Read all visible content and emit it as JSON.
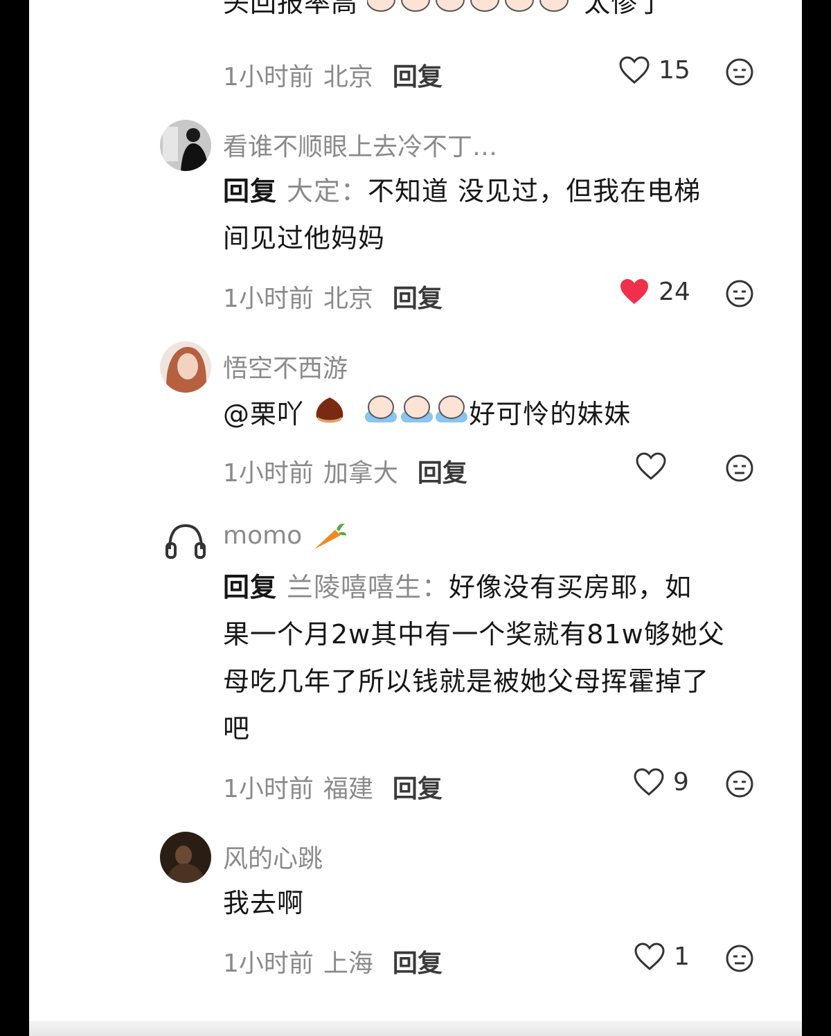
{
  "top_comment": {
    "body_partial": "头回报率高",
    "body_suffix": "太惨了",
    "time": "1小时前",
    "location": "北京",
    "reply_label": "回复",
    "likes": "15",
    "liked": false
  },
  "comments": [
    {
      "username": "看谁不顺眼上去冷不丁…",
      "reply_prefix": "回复",
      "reply_to": "大定：",
      "text_line1": "不知道 没见过，但我在电梯",
      "text_line2": "间见过他妈妈",
      "time": "1小时前",
      "location": "北京",
      "reply_label": "回复",
      "likes": "24",
      "liked": true
    },
    {
      "username": "悟空不西游",
      "mention": "@栗吖",
      "text": "好可怜的妹妹",
      "time": "1小时前",
      "location": "加拿大",
      "reply_label": "回复",
      "likes": "",
      "liked": false
    },
    {
      "username": "momo",
      "reply_prefix": "回复",
      "reply_to": "兰陵嘻嘻生：",
      "text_line1": "好像没有买房耶，如",
      "text_line2": "果一个月2w其中有一个奖就有81w够她父",
      "text_line3": "母吃几年了所以钱就是被她父母挥霍掉了",
      "text_line4": "吧",
      "time": "1小时前",
      "location": "福建",
      "reply_label": "回复",
      "likes": "9",
      "liked": false
    },
    {
      "username": "风的心跳",
      "text": "我去啊",
      "time": "1小时前",
      "location": "上海",
      "reply_label": "回复",
      "likes": "1",
      "liked": false
    }
  ],
  "colors": {
    "liked_heart": "#f0304a",
    "meta_gray": "#8a8a8a",
    "text": "#161616"
  }
}
